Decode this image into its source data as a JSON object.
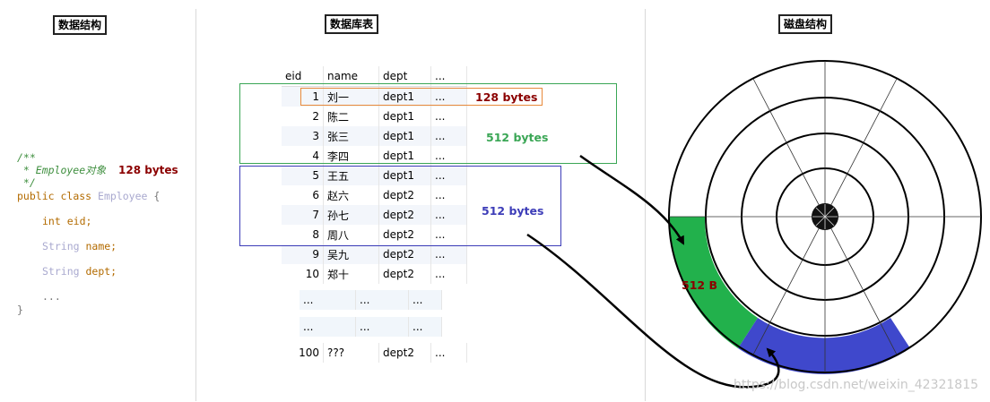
{
  "sections": {
    "data_structure": "数据结构",
    "db_table": "数据库表",
    "disk_structure": "磁盘结构"
  },
  "code": {
    "line1": "/**",
    "line2": " * Employee对象",
    "size_label": "128 bytes",
    "line3": " */",
    "kw_public": "public",
    "kw_class": "class",
    "class_name": "Employee",
    "brace_open": "{",
    "type_int": "int",
    "field_eid": "eid;",
    "type_string": "String",
    "field_name": "name;",
    "field_dept": "dept;",
    "ellipsis": "...",
    "brace_close": "}"
  },
  "table": {
    "headers": [
      "eid",
      "name",
      "dept",
      "..."
    ],
    "rows": [
      [
        "1",
        "刘一",
        "dept1",
        "..."
      ],
      [
        "2",
        "陈二",
        "dept1",
        "..."
      ],
      [
        "3",
        "张三",
        "dept1",
        "..."
      ],
      [
        "4",
        "李四",
        "dept1",
        "..."
      ],
      [
        "5",
        "王五",
        "dept1",
        "..."
      ],
      [
        "6",
        "赵六",
        "dept2",
        "..."
      ],
      [
        "7",
        "孙七",
        "dept2",
        "..."
      ],
      [
        "8",
        "周八",
        "dept2",
        "..."
      ],
      [
        "9",
        "吴九",
        "dept2",
        "..."
      ],
      [
        "10",
        "郑十",
        "dept2",
        "..."
      ]
    ],
    "gap_rows": [
      [
        "...",
        "...",
        "..."
      ],
      [
        "...",
        "...",
        "..."
      ]
    ],
    "last_row": [
      "100",
      "???",
      "dept2",
      "..."
    ]
  },
  "annotations": {
    "row_size": "128 bytes",
    "block1_size": "512 bytes",
    "block2_size": "512 bytes",
    "sector_size": "512 B"
  },
  "colors": {
    "orange": "#e8893a",
    "green": "#3aa655",
    "blue": "#3d3db8",
    "dark_red": "#8b0000",
    "sector_green": "#22b14c",
    "sector_blue": "#3f48cc"
  },
  "watermark": "https://blog.csdn.net/weixin_42321815"
}
